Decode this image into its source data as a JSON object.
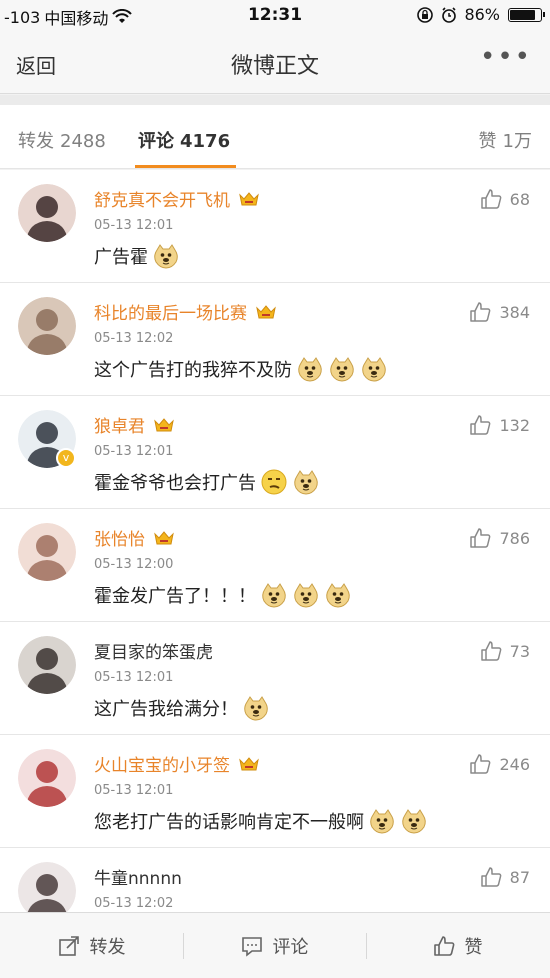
{
  "status_bar": {
    "signal": "-103",
    "carrier": "中国移动",
    "time": "12:31",
    "battery": "86%",
    "battery_level": 0.86
  },
  "nav": {
    "back_label": "返回",
    "title": "微博正文",
    "more_label": "•••"
  },
  "tabs": {
    "repost_label": "转发",
    "repost_count": "2488",
    "comment_label": "评论",
    "comment_count": "4176",
    "like_label": "赞",
    "like_count": "1万"
  },
  "colors": {
    "accent": "#f28c1e",
    "vip_name": "#e8842a",
    "crown": "#f4b51c"
  },
  "comments": [
    {
      "name": "舒克真不会开飞机",
      "vip": true,
      "time": "05-13 12:01",
      "text": "广告霍",
      "emojis": [
        "doge-emoji"
      ],
      "likes": "68"
    },
    {
      "name": "科比的最后一场比赛",
      "vip": true,
      "time": "05-13 12:02",
      "text": "这个广告打的我猝不及防",
      "emojis": [
        "doge-emoji",
        "doge-emoji",
        "doge-emoji"
      ],
      "likes": "384"
    },
    {
      "name": "狼卓君",
      "vip": true,
      "time": "05-13 12:01",
      "text": "霍金爷爷也会打广告",
      "emojis": [
        "smirk-emoji",
        "doge-emoji"
      ],
      "likes": "132"
    },
    {
      "name": "张怡怡",
      "vip": true,
      "time": "05-13 12:00",
      "text": "霍金发广告了！！！",
      "emojis": [
        "doge-emoji",
        "doge-emoji",
        "doge-emoji"
      ],
      "likes": "786"
    },
    {
      "name": "夏目家的笨蛋虎",
      "vip": false,
      "time": "05-13 12:01",
      "text": "这广告我给满分！",
      "emojis": [
        "doge-emoji"
      ],
      "likes": "73"
    },
    {
      "name": "火山宝宝的小牙签",
      "vip": true,
      "time": "05-13 12:01",
      "text": "您老打广告的话影响肯定不一般啊",
      "emojis": [
        "doge-emoji",
        "doge-emoji"
      ],
      "likes": "246"
    },
    {
      "name": "牛童nnnnn",
      "vip": false,
      "time": "05-13 12:02",
      "text": "",
      "emojis": [],
      "likes": "87"
    }
  ],
  "bottom_bar": {
    "repost_label": "转发",
    "comment_label": "评论",
    "like_label": "赞"
  }
}
